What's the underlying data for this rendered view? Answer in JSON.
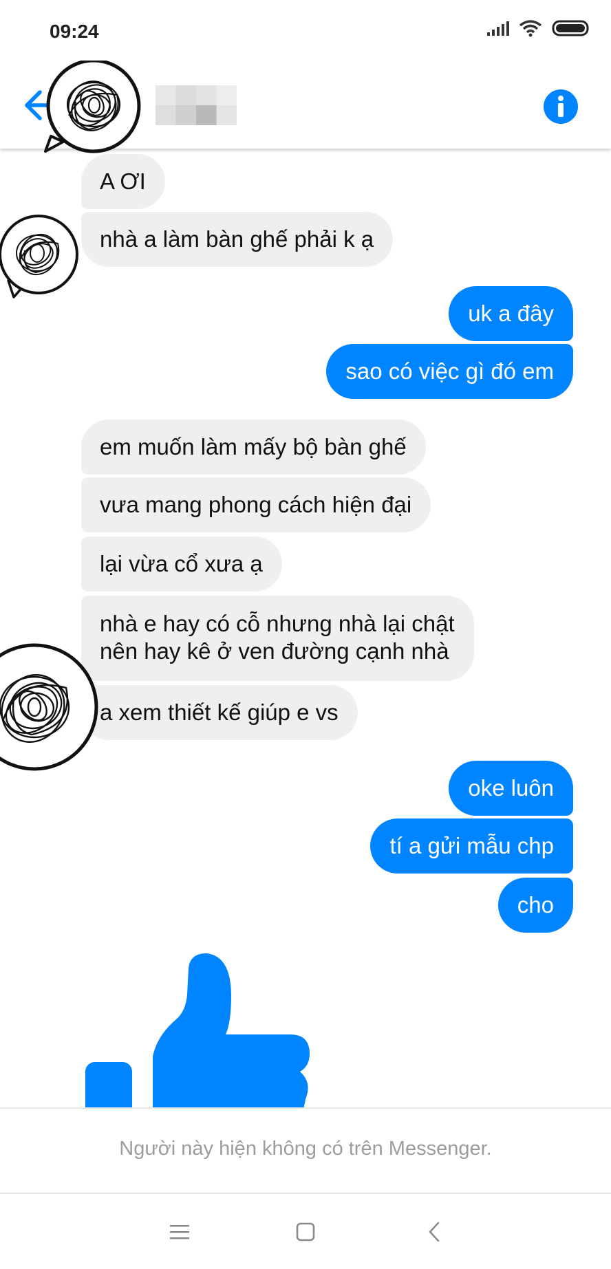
{
  "status_bar": {
    "time": "09:24",
    "icons": [
      "signal-icon",
      "wifi-icon",
      "battery-icon"
    ]
  },
  "header": {
    "back_icon": "arrow-left-icon",
    "contact_name": "",
    "info_icon": "info-icon"
  },
  "messages": [
    {
      "from": "them",
      "text": "A ƠI"
    },
    {
      "from": "them",
      "text": "nhà a làm bàn ghế phải k ạ"
    },
    {
      "from": "me",
      "text": "uk a đây"
    },
    {
      "from": "me",
      "text": "sao có việc gì đó em"
    },
    {
      "from": "them",
      "text": "em muốn làm mấy bộ bàn ghế"
    },
    {
      "from": "them",
      "text": "vưa mang phong cách hiện đại"
    },
    {
      "from": "them",
      "text": "lại vừa cổ xưa ạ"
    },
    {
      "from": "them",
      "text": "nhà e hay có cỗ nhưng nhà lại chật"
    },
    {
      "from": "them",
      "text": "nên hay kê ở ven đường cạnh nhà"
    },
    {
      "from": "them",
      "text": "a xem thiết kế giúp e vs"
    },
    {
      "from": "me",
      "text": "oke luôn"
    },
    {
      "from": "me",
      "text": "tí a gửi mẫu chp"
    },
    {
      "from": "me",
      "text": "cho"
    }
  ],
  "sticker": "thumbs-up-icon",
  "footer": {
    "unavailable_text": "Người này hiện không có trên Messenger."
  },
  "nav": [
    "menu-icon",
    "home-icon",
    "back-icon"
  ],
  "colors": {
    "accent": "#0084ff",
    "incoming_bubble": "#efefef",
    "outgoing_text": "#ffffff",
    "muted_text": "#9c9c9c"
  }
}
